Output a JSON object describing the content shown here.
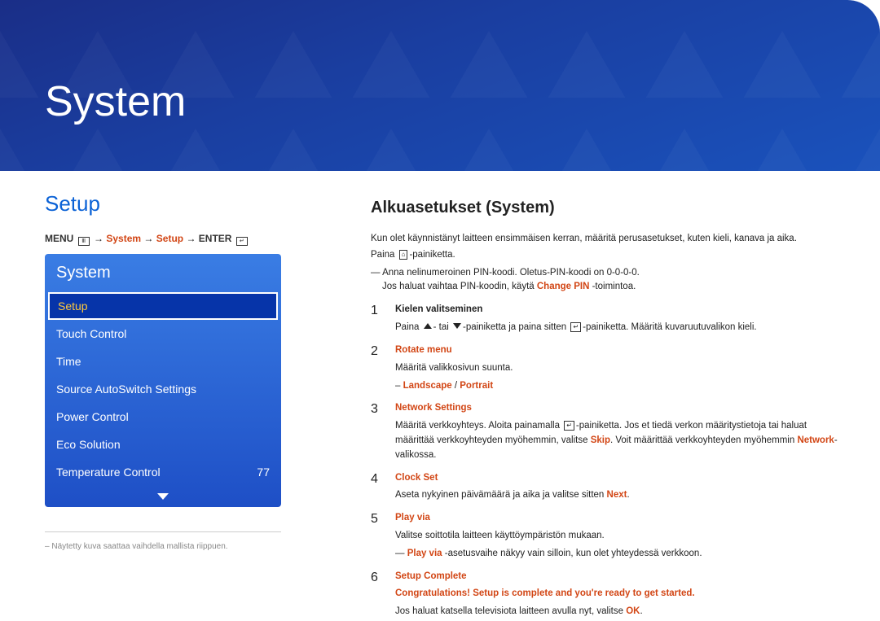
{
  "hero": {
    "title": "System"
  },
  "left": {
    "heading": "Setup",
    "breadcrumb": {
      "menu": "MENU",
      "arrow": "→",
      "system": "System",
      "setup": "Setup",
      "enter": "ENTER"
    },
    "menu": {
      "header": "System",
      "items": [
        {
          "label": "Setup",
          "value": "",
          "selected": true
        },
        {
          "label": "Touch Control",
          "value": ""
        },
        {
          "label": "Time",
          "value": ""
        },
        {
          "label": "Source AutoSwitch Settings",
          "value": ""
        },
        {
          "label": "Power Control",
          "value": ""
        },
        {
          "label": "Eco Solution",
          "value": ""
        },
        {
          "label": "Temperature Control",
          "value": "77"
        }
      ]
    },
    "footnote": "Näytetty kuva saattaa vaihdella mallista riippuen."
  },
  "right": {
    "title": "Alkuasetukset (System)",
    "intro1": "Kun olet käynnistänyt laitteen ensimmäisen kerran, määritä perusasetukset, kuten kieli, kanava ja aika.",
    "intro2a": "Paina ",
    "intro2b": "-painiketta.",
    "pin1": "Anna nelinumeroinen PIN-koodi. Oletus-PIN-koodi on 0-0-0-0.",
    "pin2a": "Jos haluat vaihtaa PIN-koodin, käytä ",
    "pin2hl": "Change PIN",
    "pin2b": " -toimintoa.",
    "steps": {
      "s1": {
        "num": "1",
        "title": "Kielen valitseminen",
        "body_a": "Paina ",
        "body_b": "- tai ",
        "body_c": "-painiketta ja paina sitten ",
        "body_d": "-painiketta. Määritä kuvaruutuvalikon kieli."
      },
      "s2": {
        "num": "2",
        "title": "Rotate menu",
        "body": "Määritä valikkosivun suunta.",
        "opt_a": "Landscape",
        "opt_sep": " / ",
        "opt_b": "Portrait"
      },
      "s3": {
        "num": "3",
        "title": "Network Settings",
        "body_a": "Määritä verkkoyhteys. Aloita painamalla ",
        "body_b": "-painiketta. Jos et tiedä verkon määritystietoja tai haluat määrittää verkkoyhteyden myöhemmin, valitse ",
        "skip": "Skip",
        "body_c": ". Voit määrittää verkkoyhteyden myöhemmin ",
        "nw": "Network",
        "body_d": "-valikossa."
      },
      "s4": {
        "num": "4",
        "title": "Clock Set",
        "body_a": "Aseta nykyinen päivämäärä ja aika ja valitse sitten ",
        "next": "Next",
        "body_b": "."
      },
      "s5": {
        "num": "5",
        "title": "Play via",
        "body": "Valitse soittotila laitteen käyttöympäristön mukaan.",
        "note_a": "Play via",
        "note_b": " -asetusvaihe näkyy vain silloin, kun olet yhteydessä verkkoon."
      },
      "s6": {
        "num": "6",
        "title": "Setup Complete",
        "congrats": "Congratulations! Setup is complete and you're ready to get started.",
        "body_a": "Jos haluat katsella televisiota laitteen avulla nyt, valitse ",
        "ok": "OK",
        "body_b": "."
      }
    }
  }
}
